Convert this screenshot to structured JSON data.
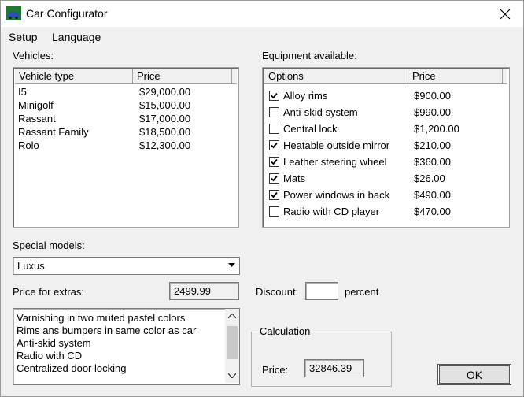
{
  "window": {
    "title": "Car Configurator",
    "app_icon": "car-icon",
    "close_icon": "close-icon"
  },
  "menu": [
    "Setup",
    "Language"
  ],
  "vehicles": {
    "label": "Vehicles:",
    "columns": [
      "Vehicle type",
      "Price"
    ],
    "rows": [
      [
        "I5",
        "$29,000.00"
      ],
      [
        "Minigolf",
        "$15,000.00"
      ],
      [
        "Rassant",
        "$17,000.00"
      ],
      [
        "Rassant Family",
        "$18,500.00"
      ],
      [
        "Rolo",
        "$12,300.00"
      ]
    ]
  },
  "equipment": {
    "label": "Equipment available:",
    "columns": [
      "Options",
      "Price"
    ],
    "rows": [
      {
        "name": "Alloy rims",
        "price": "$900.00",
        "checked": true
      },
      {
        "name": "Anti-skid system",
        "price": "$990.00",
        "checked": false
      },
      {
        "name": "Central lock",
        "price": "$1,200.00",
        "checked": false
      },
      {
        "name": "Heatable outside mirror",
        "price": "$210.00",
        "checked": true
      },
      {
        "name": "Leather steering wheel",
        "price": "$360.00",
        "checked": true
      },
      {
        "name": "Mats",
        "price": "$26.00",
        "checked": true
      },
      {
        "name": "Power windows in back",
        "price": "$490.00",
        "checked": true
      },
      {
        "name": "Radio with CD player",
        "price": "$470.00",
        "checked": false
      }
    ]
  },
  "special_models": {
    "label": "Special models:",
    "selected": "Luxus"
  },
  "extras": {
    "label": "Price for extras:",
    "value": "2499.99"
  },
  "discount": {
    "label": "Discount:",
    "value": "",
    "suffix": "percent"
  },
  "model_description": {
    "lines": [
      "Varnishing in two muted pastel colors",
      "Rims ans bumpers in same color as car",
      "Anti-skid system",
      "Radio with CD",
      "Centralized door locking"
    ]
  },
  "calculation": {
    "title": "Calculation",
    "price_label": "Price:",
    "price_value": "32846.39"
  },
  "ok_button": "OK",
  "colors": {
    "window_bg": "#f0f0f0",
    "field_bg": "#ffffff",
    "border": "#a0a0a0"
  }
}
